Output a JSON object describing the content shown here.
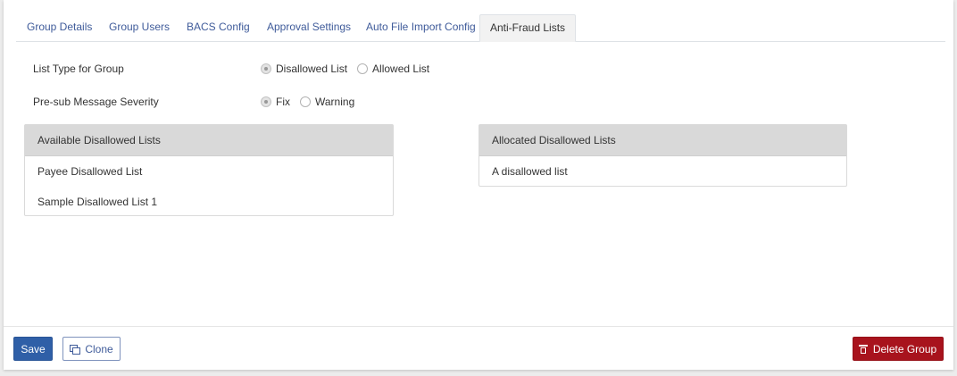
{
  "tabs": [
    {
      "label": "Group Details"
    },
    {
      "label": "Group Users"
    },
    {
      "label": "BACS Config"
    },
    {
      "label": "Approval Settings"
    },
    {
      "label": "Auto File Import Config"
    },
    {
      "label": "Anti-Fraud Lists",
      "active": true
    }
  ],
  "list_type": {
    "label": "List Type for Group",
    "options": [
      "Disallowed List",
      "Allowed List"
    ],
    "selected": "Disallowed List"
  },
  "severity": {
    "label": "Pre-sub Message Severity",
    "options": [
      "Fix",
      "Warning"
    ],
    "selected": "Fix"
  },
  "available_lists": {
    "title": "Available Disallowed Lists",
    "items": [
      "Payee Disallowed List",
      "Sample Disallowed List 1"
    ]
  },
  "allocated_lists": {
    "title": "Allocated Disallowed Lists",
    "items": [
      "A disallowed list"
    ]
  },
  "footer": {
    "save_label": "Save",
    "clone_label": "Clone",
    "delete_label": "Delete Group"
  },
  "colors": {
    "primary": "#2f5fa7",
    "danger": "#a8131d",
    "tab_link": "#3f5b9a"
  }
}
